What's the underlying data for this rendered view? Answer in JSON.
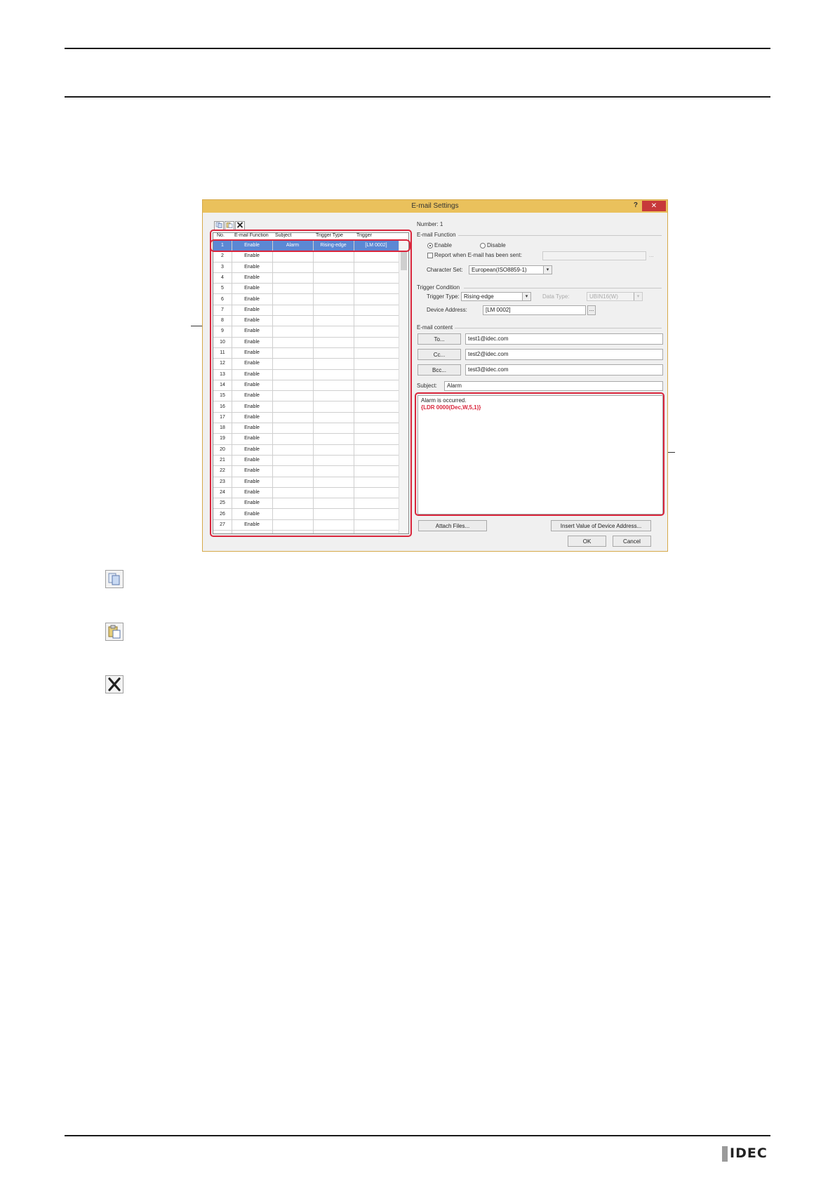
{
  "dialog": {
    "title": "E-mail Settings",
    "help_label": "?",
    "close_label": "✕",
    "grid": {
      "headers": [
        "No.",
        "E-mail Function",
        "Subject",
        "Trigger Type",
        "Trigger"
      ],
      "rows": [
        {
          "no": "1",
          "func": "Enable",
          "subject": "Alarm",
          "ttype": "Rising-edge",
          "trigger": "[LM 0002]",
          "selected": true
        },
        {
          "no": "2",
          "func": "Enable"
        },
        {
          "no": "3",
          "func": "Enable"
        },
        {
          "no": "4",
          "func": "Enable"
        },
        {
          "no": "5",
          "func": "Enable"
        },
        {
          "no": "6",
          "func": "Enable"
        },
        {
          "no": "7",
          "func": "Enable"
        },
        {
          "no": "8",
          "func": "Enable"
        },
        {
          "no": "9",
          "func": "Enable"
        },
        {
          "no": "10",
          "func": "Enable"
        },
        {
          "no": "11",
          "func": "Enable"
        },
        {
          "no": "12",
          "func": "Enable"
        },
        {
          "no": "13",
          "func": "Enable"
        },
        {
          "no": "14",
          "func": "Enable"
        },
        {
          "no": "15",
          "func": "Enable"
        },
        {
          "no": "16",
          "func": "Enable"
        },
        {
          "no": "17",
          "func": "Enable"
        },
        {
          "no": "18",
          "func": "Enable"
        },
        {
          "no": "19",
          "func": "Enable"
        },
        {
          "no": "20",
          "func": "Enable"
        },
        {
          "no": "21",
          "func": "Enable"
        },
        {
          "no": "22",
          "func": "Enable"
        },
        {
          "no": "23",
          "func": "Enable"
        },
        {
          "no": "24",
          "func": "Enable"
        },
        {
          "no": "25",
          "func": "Enable"
        },
        {
          "no": "26",
          "func": "Enable"
        },
        {
          "no": "27",
          "func": "Enable"
        }
      ]
    },
    "number_label": "Number: 1",
    "email_function": {
      "section": "E-mail Function",
      "enable": "Enable",
      "disable": "Disable",
      "report_label": "Report when E-mail has been sent:",
      "charset_label": "Character Set:",
      "charset_value": "European(ISO8859-1)"
    },
    "trigger_condition": {
      "section": "Trigger Condition",
      "type_label": "Trigger Type:",
      "type_value": "Rising-edge",
      "data_type_label": "Data Type:",
      "data_type_value": "UBIN16(W)",
      "device_label": "Device Address:",
      "device_value": "[LM 0002]",
      "browse": "..."
    },
    "content": {
      "section": "E-mail content",
      "to_btn": "To...",
      "to_value": "test1@idec.com",
      "cc_btn": "Cc...",
      "cc_value": "test2@idec.com",
      "bcc_btn": "Bcc...",
      "bcc_value": "test3@idec.com",
      "subject_label": "Subject:",
      "subject_value": "Alarm",
      "body_line1": "Alarm is occurred.",
      "body_line2": "{LDR 0000(Dec,W,5,1)}"
    },
    "buttons": {
      "attach": "Attach Files...",
      "insert": "Insert Value of Device Address...",
      "ok": "OK",
      "cancel": "Cancel"
    }
  },
  "footer": {
    "logo": "IDEC"
  }
}
